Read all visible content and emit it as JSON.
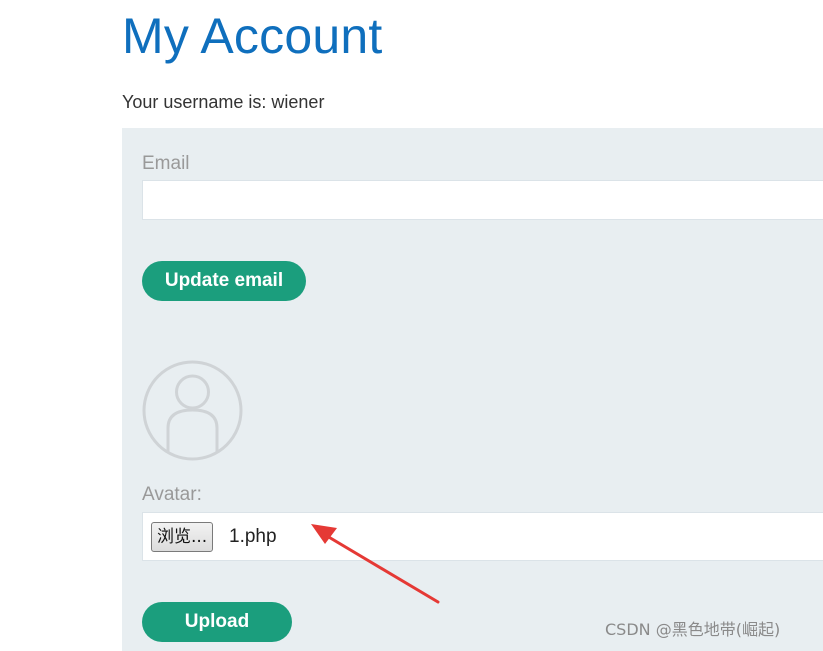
{
  "page": {
    "title": "My Account",
    "username_line": "Your username is: wiener"
  },
  "email_form": {
    "label": "Email",
    "value": "",
    "button_label": "Update email"
  },
  "avatar_form": {
    "label": "Avatar:",
    "browse_label": "浏览...",
    "selected_file": "1.php",
    "upload_label": "Upload"
  },
  "annotation": {
    "arrow_color": "#e53935"
  },
  "watermark": "CSDN @黑色地带(崛起)",
  "colors": {
    "title": "#0f6fbd",
    "panel_bg": "#e8eef1",
    "button_bg": "#1b9e7d",
    "label": "#999999"
  },
  "icons": {
    "avatar": "user-silhouette-icon",
    "arrow": "red-arrow-icon"
  }
}
